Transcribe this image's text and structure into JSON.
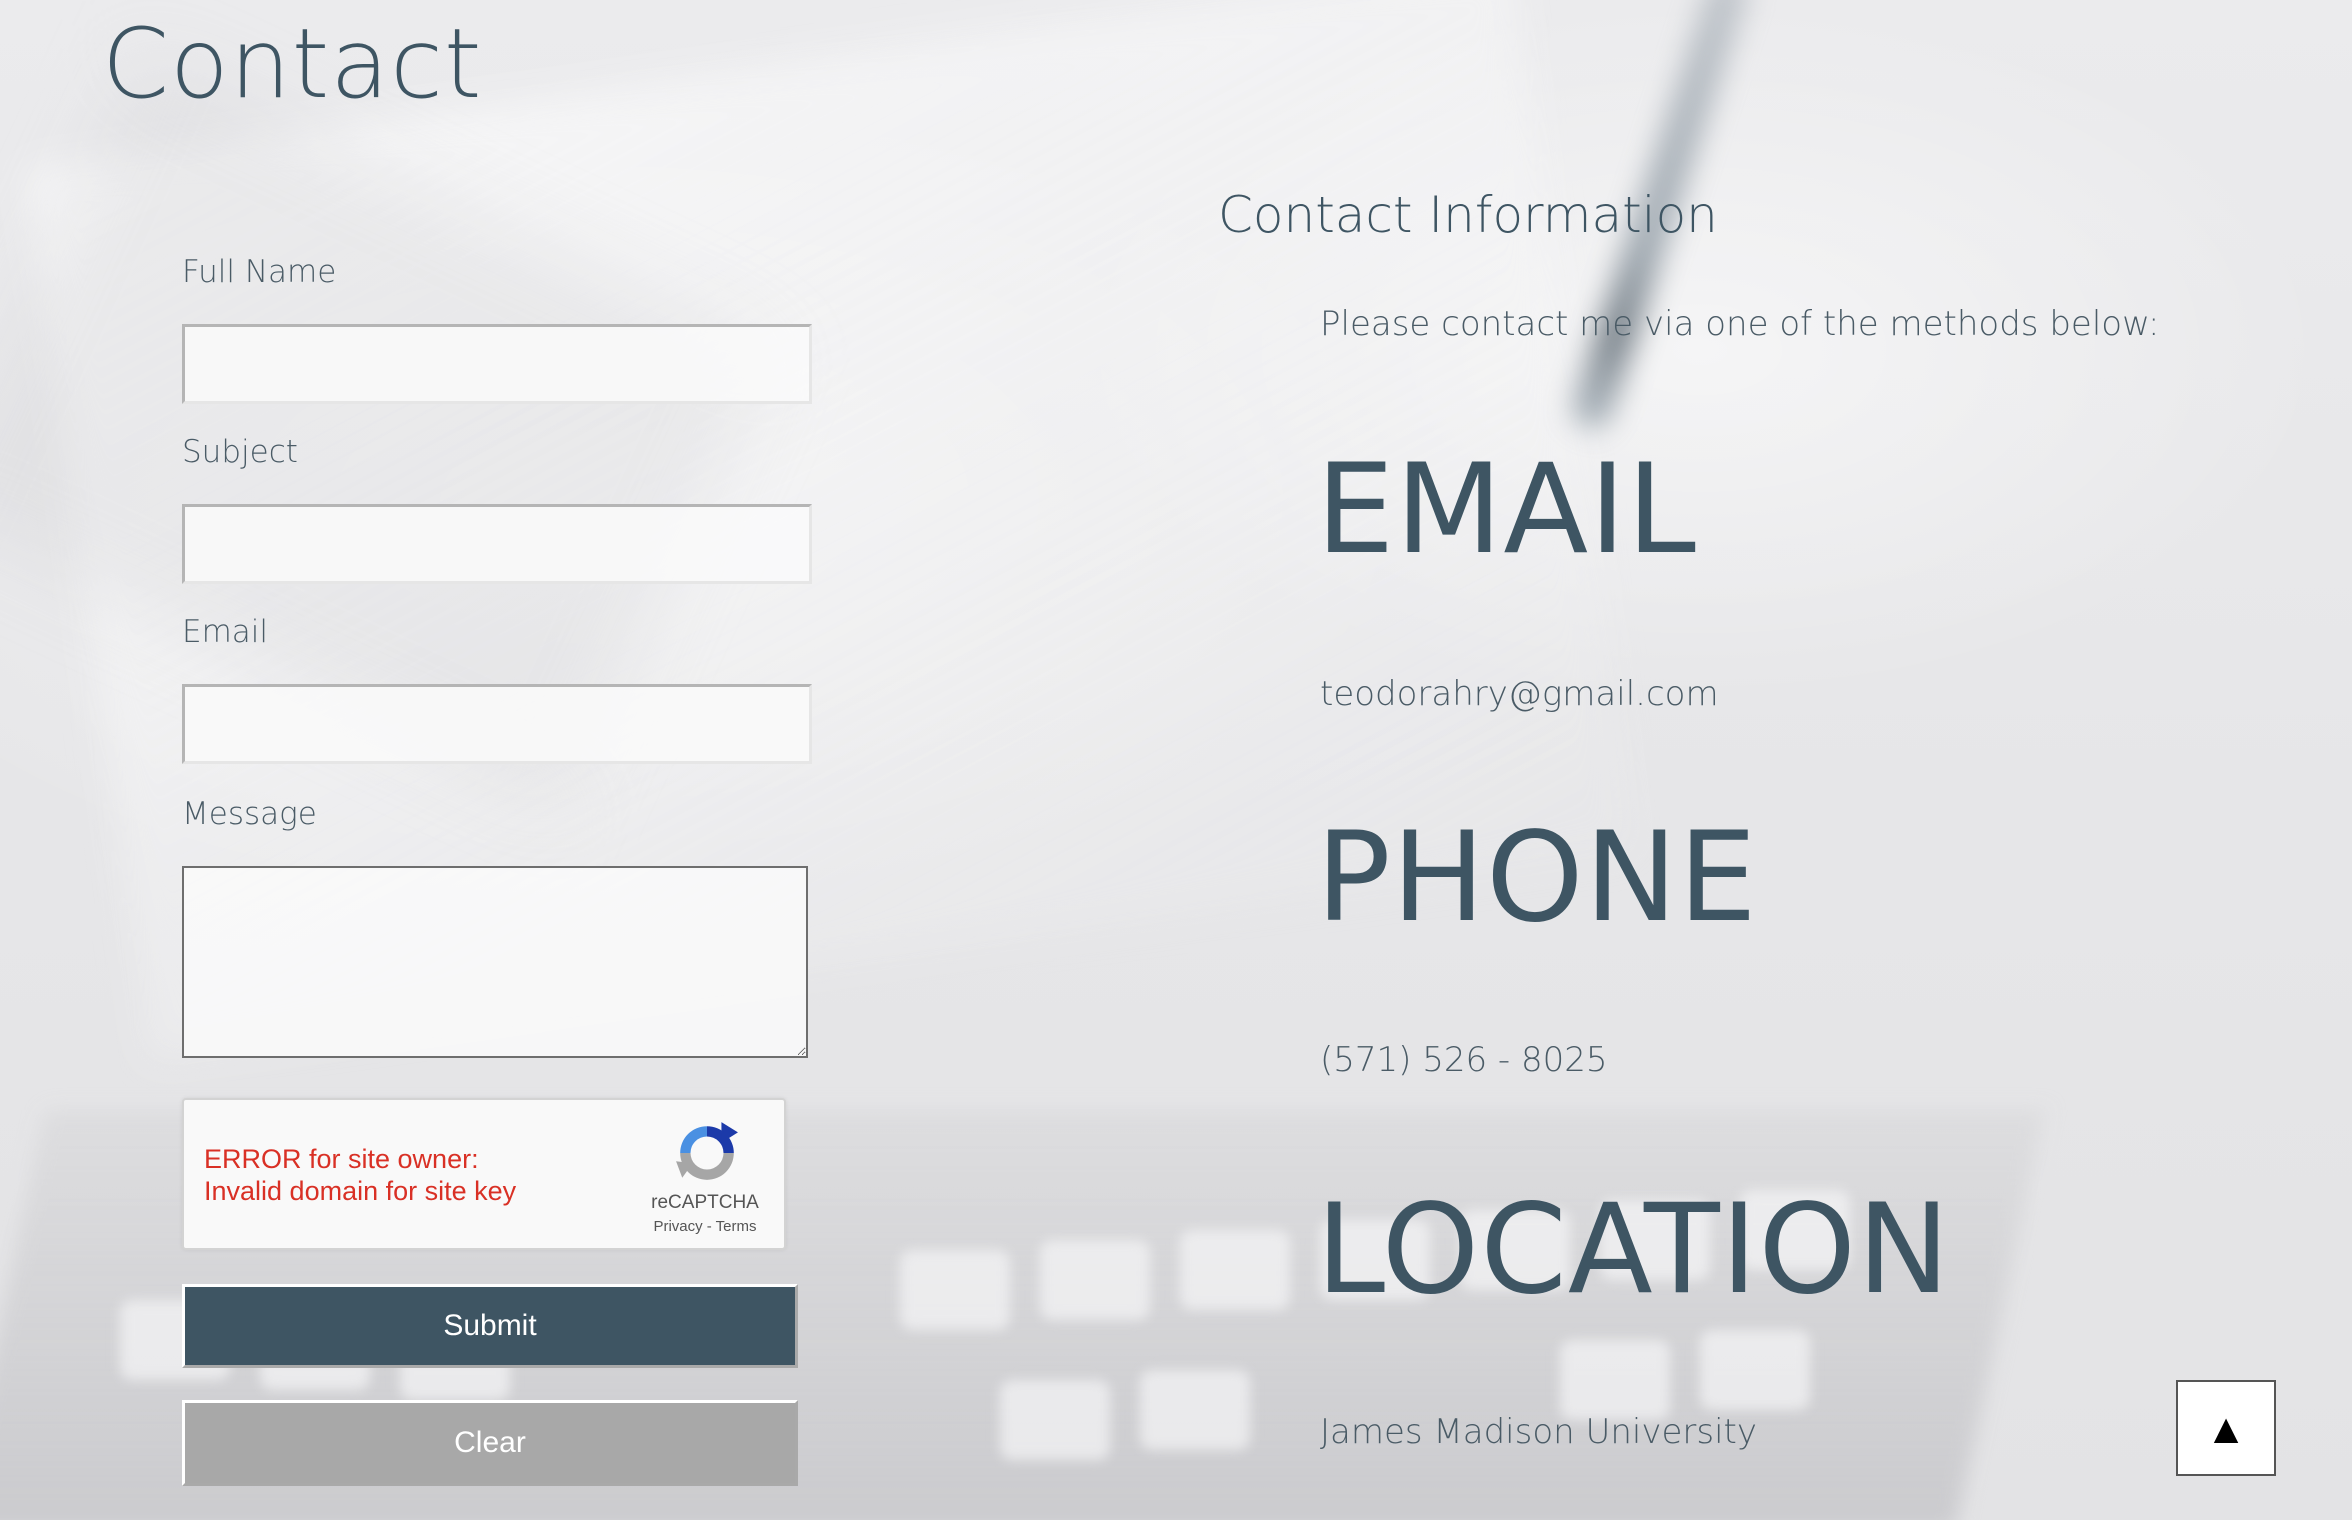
{
  "page": {
    "title": "Contact"
  },
  "form": {
    "full_name_label": "Full Name",
    "full_name_value": "",
    "subject_label": "Subject",
    "subject_value": "",
    "email_label": "Email",
    "email_value": "",
    "message_label": "Message",
    "message_value": "",
    "recaptcha": {
      "error_line1": "ERROR for site owner:",
      "error_line2": "Invalid domain for site key",
      "brand": "reCAPTCHA",
      "links": "Privacy - Terms"
    },
    "submit_label": "Submit",
    "clear_label": "Clear"
  },
  "contact_info": {
    "title": "Contact Information",
    "intro": "Please contact me via one of the methods below:",
    "email_heading": "EMAIL",
    "email_value": "teodorahry@gmail.com",
    "phone_heading": "PHONE",
    "phone_value": "(571) 526 - 8025",
    "location_heading": "LOCATION",
    "location_value": "James Madison University"
  },
  "scroll_top": {
    "glyph": "▲"
  },
  "colors": {
    "primary": "#3e5563",
    "clear_button": "#a8a8a8",
    "error_text": "#d93025",
    "background": "#e8e8ea"
  },
  "icons": {
    "recaptcha_logo": "recaptcha-logo-icon",
    "scroll_top": "triangle-up-icon"
  }
}
